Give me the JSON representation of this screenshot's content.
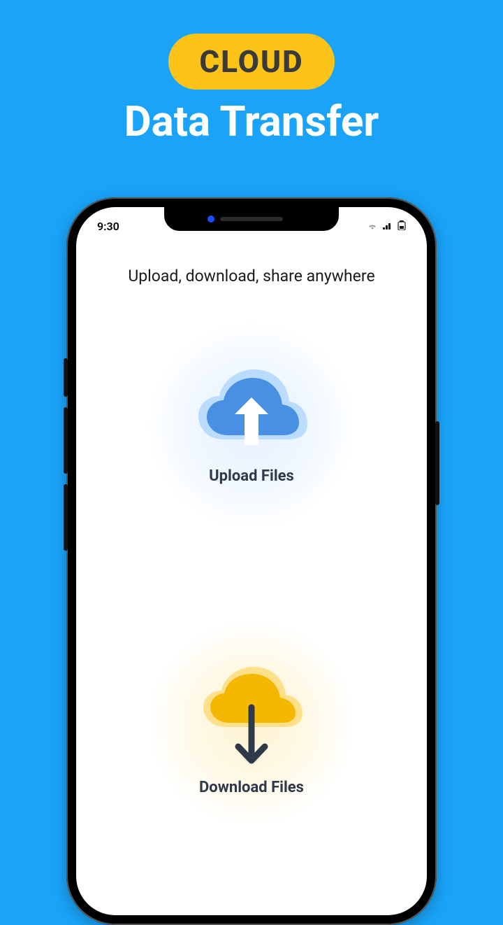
{
  "hero": {
    "badge": "CLOUD",
    "title": "Data Transfer"
  },
  "phone": {
    "statusbar": {
      "time": "9:30"
    },
    "subtitle": "Upload, download, share anywhere",
    "actions": {
      "upload": {
        "label": "Upload Files"
      },
      "download": {
        "label": "Download Files"
      }
    }
  },
  "colors": {
    "background": "#1aa3f8",
    "badge_bg": "#fcc419",
    "badge_text": "#3a3a3a",
    "title": "#ffffff",
    "upload_cloud": "#4a90e2",
    "download_cloud": "#f5b800",
    "action_label": "#2e3a4a"
  }
}
